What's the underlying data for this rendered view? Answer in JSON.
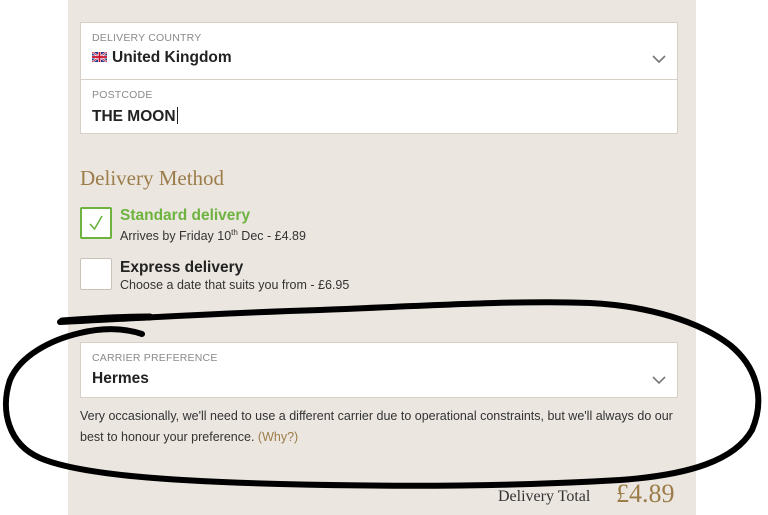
{
  "address": {
    "country_label": "DELIVERY COUNTRY",
    "country_value": "United Kingdom",
    "postcode_label": "POSTCODE",
    "postcode_value": "THE MOON"
  },
  "delivery_method": {
    "title": "Delivery Method",
    "options": [
      {
        "title": "Standard delivery",
        "sub_prefix": "Arrives by Friday 10",
        "sub_sup": "th",
        "sub_suffix": " Dec - £4.89",
        "checked": true
      },
      {
        "title": "Express delivery",
        "subtitle": "Choose a date that suits you from - £6.95",
        "checked": false
      }
    ]
  },
  "carrier": {
    "label": "CARRIER PREFERENCE",
    "value": "Hermes",
    "note": "Very occasionally, we'll need to use a different carrier due to operational constraints, but we'll always do our best to honour your preference.",
    "why_link": "(Why?)"
  },
  "total": {
    "label": "Delivery Total",
    "value": "£4.89"
  },
  "colors": {
    "accent_gold": "#9c7d4a",
    "selected_green": "#6db33f",
    "panel_bg": "#ebe6e0"
  }
}
